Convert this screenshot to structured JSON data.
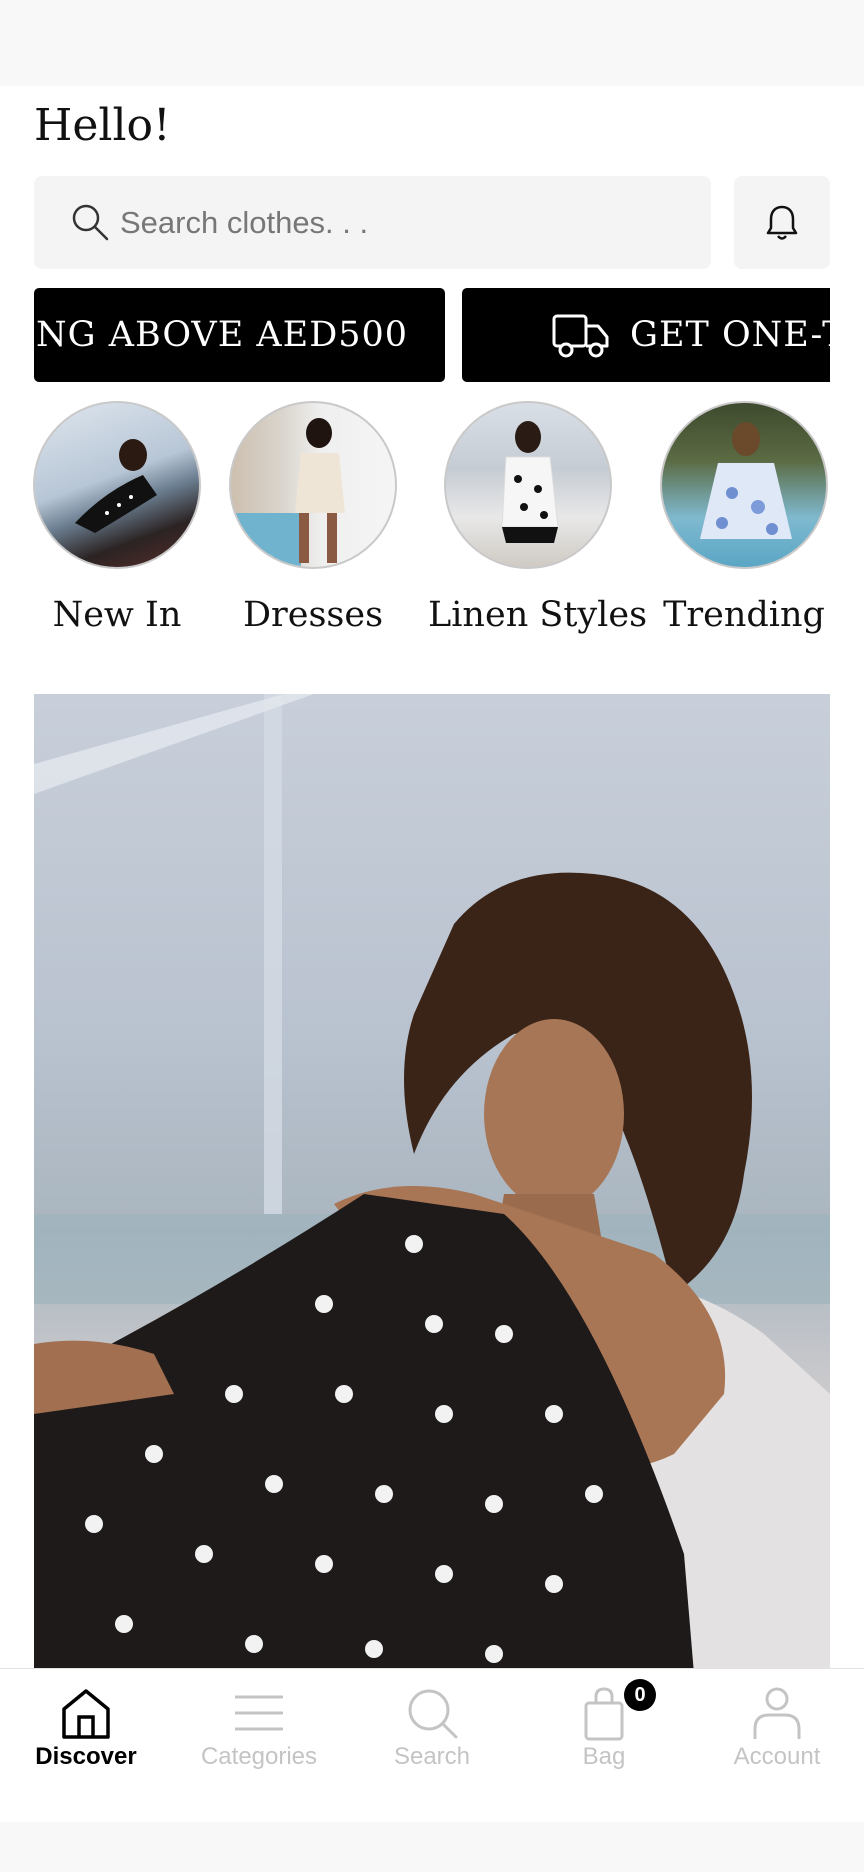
{
  "greeting": "Hello!",
  "search": {
    "placeholder": "Search clothes. . ."
  },
  "promos": [
    {
      "text": "NG ABOVE AED500"
    },
    {
      "text": "GET ONE-T"
    }
  ],
  "categories": [
    {
      "label": "New In"
    },
    {
      "label": "Dresses"
    },
    {
      "label": "Linen Styles"
    },
    {
      "label": "Trending"
    }
  ],
  "bottom_nav": [
    {
      "label": "Discover",
      "icon": "home-icon",
      "active": true
    },
    {
      "label": "Categories",
      "icon": "menu-lines-icon",
      "active": false
    },
    {
      "label": "Search",
      "icon": "search-icon",
      "active": false
    },
    {
      "label": "Bag",
      "icon": "bag-icon",
      "active": false,
      "badge": "0"
    },
    {
      "label": "Account",
      "icon": "person-icon",
      "active": false
    }
  ],
  "colors": {
    "accent": "#000000",
    "inactive": "#c4c4c4",
    "surface": "#f4f4f4"
  }
}
